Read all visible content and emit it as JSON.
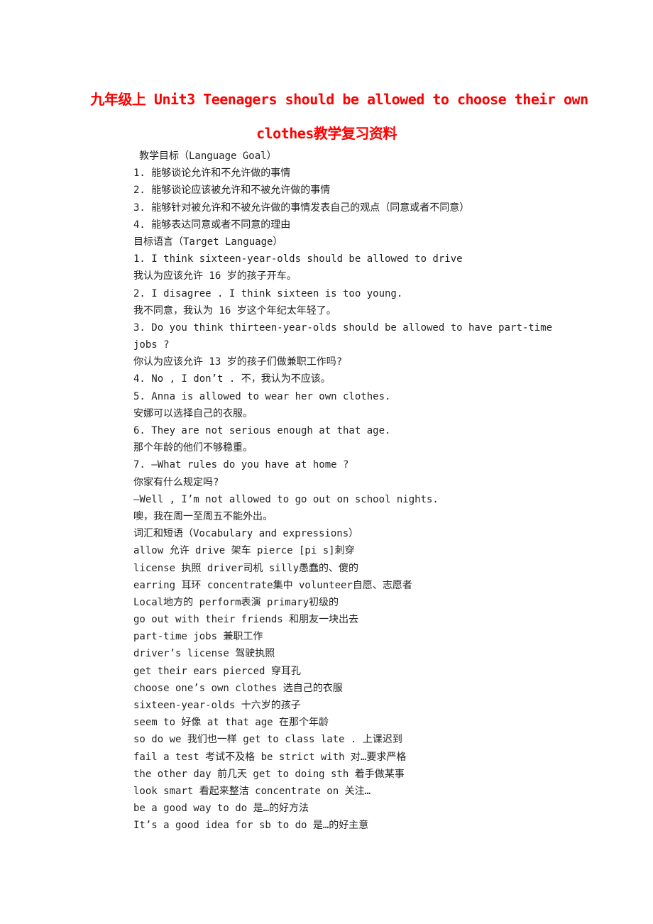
{
  "title": {
    "line1": "九年级上 Unit3 Teenagers should be allowed to choose their own",
    "line2": "clothes教学复习资料"
  },
  "language_goal": {
    "header": "教学目标（Language Goal）",
    "items": [
      "1. 能够谈论允许和不允许做的事情",
      "2. 能够谈论应该被允许和不被允许做的事情",
      "3. 能够针对被允许和不被允许做的事情发表自己的观点（同意或者不同意）",
      "4. 能够表达同意或者不同意的理由"
    ]
  },
  "target_language": {
    "header": "目标语言（Target Language）",
    "lines": [
      "1. I think sixteen-year-olds should be allowed to drive",
      "我认为应该允许 16 岁的孩子开车。",
      "2. I disagree . I think sixteen is too young.",
      "我不同意，我认为 16 岁这个年纪太年轻了。",
      "3. Do you think thirteen-year-olds should be allowed to have part-time",
      "jobs ?",
      "你认为应该允许 13 岁的孩子们做兼职工作吗?",
      "4. No , I don’t . 不，我认为不应该。",
      "5. Anna is allowed to wear her own clothes.",
      "安娜可以选择自己的衣服。",
      "6. They are not serious enough at that age.",
      "那个年龄的他们不够稳重。",
      "7. —What rules do you have at home ?",
      "你家有什么规定吗?",
      "—Well , I’m not allowed to go out on school nights.",
      "噢，我在周一至周五不能外出。"
    ]
  },
  "vocabulary": {
    "header": "词汇和短语（Vocabulary and expressions）",
    "lines": [
      "allow 允许 drive 架车 pierce [pi s]刺穿",
      "license 执照 driver司机 silly愚蠢的、傻的",
      "earring 耳环 concentrate集中 volunteer自愿、志愿者",
      "Local地方的 perform表演 primary初级的",
      "go out with their friends 和朋友一块出去",
      "part-time jobs 兼职工作",
      "driver’s license 驾驶执照",
      "get their ears pierced 穿耳孔",
      "choose one’s own clothes 选自己的衣服",
      "sixteen-year-olds 十六岁的孩子",
      "seem to 好像 at that age 在那个年龄",
      "so do we 我们也一样 get to class late . 上课迟到",
      "fail a test 考试不及格 be strict with 对…要求严格",
      "the other day 前几天 get to doing sth 着手做某事",
      "look smart 看起来整洁 concentrate on 关注…",
      "be a good way to do 是…的好方法",
      "It’s a good idea for sb to do 是…的好主意"
    ]
  }
}
